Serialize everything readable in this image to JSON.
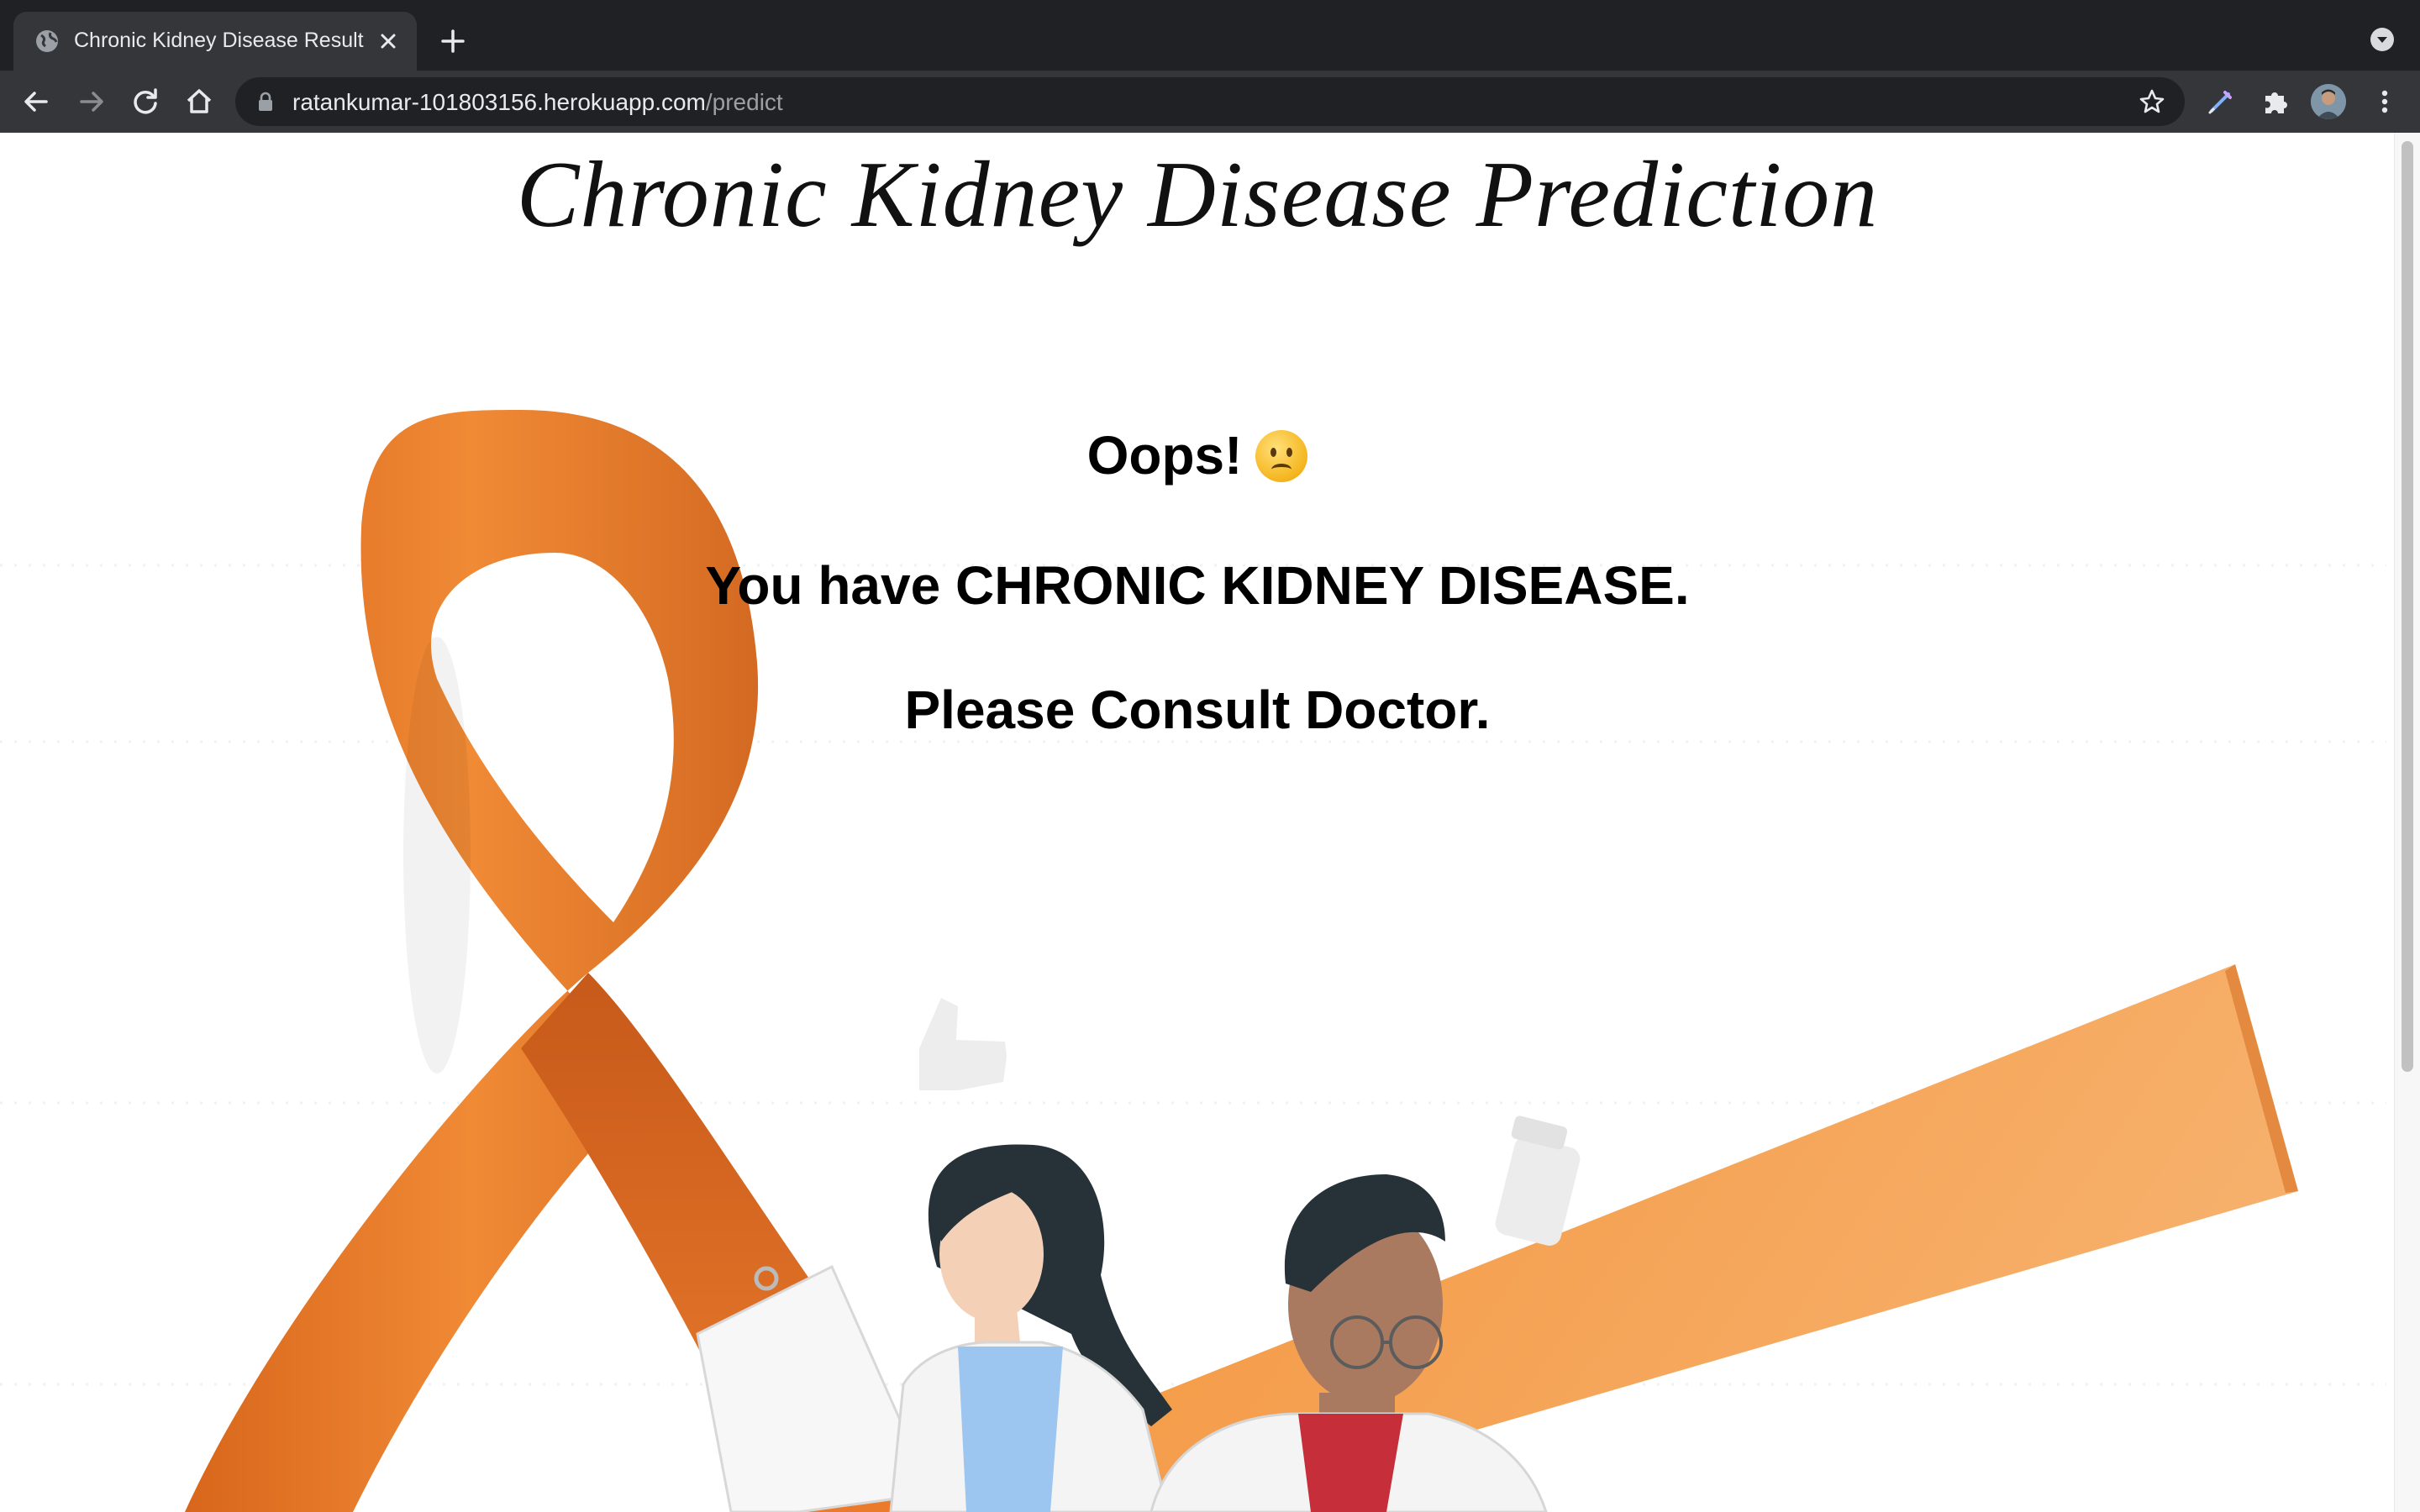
{
  "browser": {
    "tab_title": "Chronic Kidney Disease Result",
    "url_host": "ratankumar-101803156.herokuapp.com",
    "url_path": "/predict",
    "icons": [
      "globe-icon",
      "close-icon",
      "plus-icon",
      "tab-search-icon",
      "back-arrow-icon",
      "forward-arrow-icon",
      "reload-icon",
      "home-icon",
      "lock-icon",
      "star-icon",
      "pen-extension-icon",
      "puzzle-icon",
      "profile-avatar",
      "kebab-menu-icon"
    ]
  },
  "page": {
    "title": "Chronic Kidney Disease Prediction",
    "result": {
      "heading": "Oops!",
      "emoji": "slightly-frowning-face",
      "line1": "You have CHRONIC KIDNEY DISEASE.",
      "line2": "Please Consult Doctor."
    },
    "background": {
      "ribbon_color": "#ec7f2d",
      "description": "orange awareness ribbon with two doctors illustration"
    }
  },
  "colors": {
    "chrome_dark": "#202124",
    "chrome_toolbar": "#35363a",
    "chrome_text": "#e8eaed",
    "ribbon": "#ec7f2d",
    "ribbon_light": "#f6a45f"
  }
}
